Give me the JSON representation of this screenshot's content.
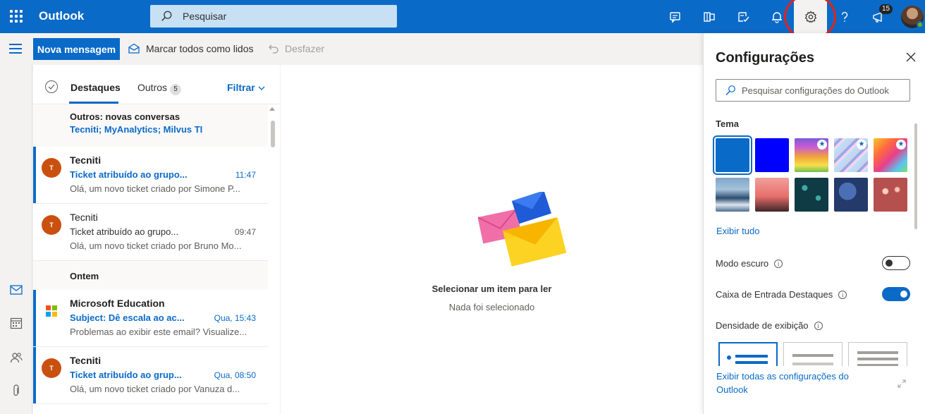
{
  "topbar": {
    "app_name": "Outlook",
    "search_placeholder": "Pesquisar",
    "notification_count": "15",
    "icons": [
      "teams-chat-icon",
      "office-apps-icon",
      "todo-icon",
      "bell-icon",
      "gear-icon",
      "help-icon",
      "feedback-icon"
    ],
    "accent": "#0a6ac8"
  },
  "commandbar": {
    "new_message": "Nova mensagem",
    "mark_all_read": "Marcar todos como lidos",
    "undo": "Desfazer"
  },
  "msglist": {
    "tabs": [
      {
        "label": "Destaques",
        "active": true
      },
      {
        "label": "Outros",
        "count": "5"
      }
    ],
    "filter": "Filtrar",
    "other_conversations": {
      "title": "Outros: novas conversas",
      "senders": "Tecniti; MyAnalytics; Milvus TI"
    },
    "group_yesterday": "Ontem",
    "items": [
      {
        "avatar": "T",
        "sender": "Tecniti",
        "subject": "Ticket atribuído ao grupo...",
        "time": "11:47",
        "preview": "Olá, um novo ticket criado por Simone P...",
        "unread": true
      },
      {
        "avatar": "T",
        "sender": "Tecniti",
        "subject": "Ticket atribuído ao grupo...",
        "time": "09:47",
        "preview": "Olá, um novo ticket criado por Bruno Mo...",
        "unread": false
      },
      {
        "avatar": "",
        "sender": "Microsoft Education",
        "subject": "Subject: Dê escala ao ac...",
        "time": "Qua, 15:43",
        "preview": "Problemas ao exibir este email? Visualize...",
        "unread": true
      },
      {
        "avatar": "T",
        "sender": "Tecniti",
        "subject": "Ticket atribuído ao grup...",
        "time": "Qua, 08:50",
        "preview": "Olá, um novo ticket criado por Vanuza d...",
        "unread": true
      }
    ]
  },
  "reading": {
    "title": "Selecionar um item para ler",
    "subtitle": "Nada foi selecionado"
  },
  "settings": {
    "title": "Configurações",
    "search_placeholder": "Pesquisar configurações do Outlook",
    "theme_label": "Tema",
    "show_all": "Exibir tudo",
    "dark_mode": "Modo escuro",
    "dark_mode_on": false,
    "focused_inbox": "Caixa de Entrada Destaques",
    "focused_inbox_on": true,
    "density_label": "Densidade de exibição",
    "footer_link": "Exibir todas as configurações do Outlook"
  }
}
